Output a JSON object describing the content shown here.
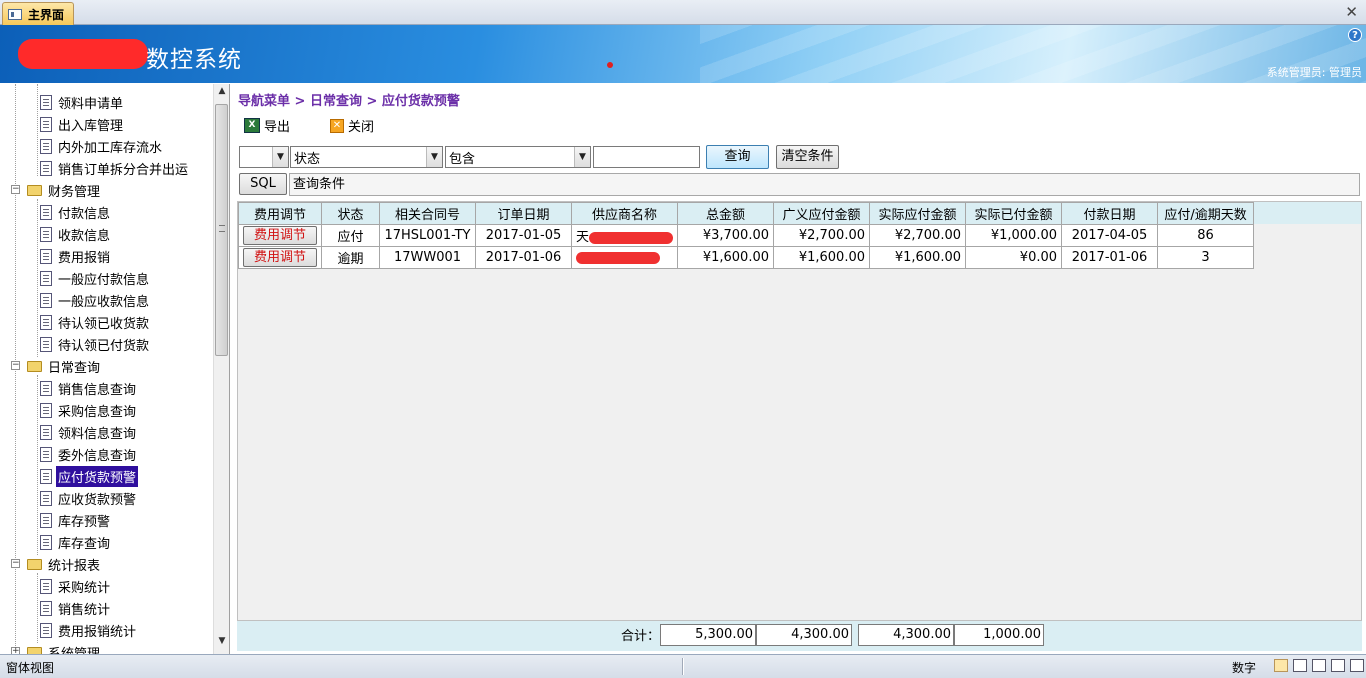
{
  "tab": {
    "title": "主界面"
  },
  "banner": {
    "title": "数控系统",
    "user": "系统管理员: 管理员"
  },
  "tree": {
    "items": [
      {
        "label": "领料申请单",
        "type": "doc"
      },
      {
        "label": "出入库管理",
        "type": "doc"
      },
      {
        "label": "内外加工库存流水",
        "type": "doc"
      },
      {
        "label": "销售订单拆分合并出运",
        "type": "doc"
      },
      {
        "label": "财务管理",
        "type": "folder"
      },
      {
        "label": "付款信息",
        "type": "doc"
      },
      {
        "label": "收款信息",
        "type": "doc"
      },
      {
        "label": "费用报销",
        "type": "doc"
      },
      {
        "label": "一般应付款信息",
        "type": "doc"
      },
      {
        "label": "一般应收款信息",
        "type": "doc"
      },
      {
        "label": "待认领已收货款",
        "type": "doc"
      },
      {
        "label": "待认领已付货款",
        "type": "doc"
      },
      {
        "label": "日常查询",
        "type": "folder"
      },
      {
        "label": "销售信息查询",
        "type": "doc"
      },
      {
        "label": "采购信息查询",
        "type": "doc"
      },
      {
        "label": "领料信息查询",
        "type": "doc"
      },
      {
        "label": "委外信息查询",
        "type": "doc"
      },
      {
        "label": "应付货款预警",
        "type": "doc",
        "selected": true
      },
      {
        "label": "应收货款预警",
        "type": "doc"
      },
      {
        "label": "库存预警",
        "type": "doc"
      },
      {
        "label": "库存查询",
        "type": "doc"
      },
      {
        "label": "统计报表",
        "type": "folder"
      },
      {
        "label": "采购统计",
        "type": "doc"
      },
      {
        "label": "销售统计",
        "type": "doc"
      },
      {
        "label": "费用报销统计",
        "type": "doc"
      },
      {
        "label": "系统管理",
        "type": "folder"
      }
    ]
  },
  "main": {
    "breadcrumb": "导航菜单 > 日常查询 > 应付货款预警",
    "export_label": "导出",
    "close_label": "关闭",
    "filter": {
      "field1": "",
      "field2": "状态",
      "operator": "包含",
      "value": "",
      "query_label": "查询",
      "clear_label": "清空条件",
      "sql_label": "SQL",
      "condition_text": "查询条件"
    },
    "columns": [
      "费用调节",
      "状态",
      "相关合同号",
      "订单日期",
      "供应商名称",
      "总金额",
      "广义应付金额",
      "实际应付金额",
      "实际已付金额",
      "付款日期",
      "应付/逾期天数"
    ],
    "rows": [
      {
        "btn": "费用调节",
        "status": "应付",
        "contract": "17HSL001-TY",
        "order_date": "2017-01-05",
        "supplier": "天",
        "total": "¥3,700.00",
        "general_payable": "¥2,700.00",
        "actual_payable": "¥2,700.00",
        "paid": "¥1,000.00",
        "pay_date": "2017-04-05",
        "days": "86"
      },
      {
        "btn": "费用调节",
        "status": "逾期",
        "contract": "17WW001",
        "order_date": "2017-01-06",
        "supplier": "",
        "total": "¥1,600.00",
        "general_payable": "¥1,600.00",
        "actual_payable": "¥1,600.00",
        "paid": "¥0.00",
        "pay_date": "2017-01-06",
        "days": "3"
      }
    ],
    "totals": {
      "label": "合计：",
      "total": "5,300.00",
      "general_payable": "4,300.00",
      "actual_payable": "4,300.00",
      "paid": "1,000.00"
    }
  },
  "statusbar": {
    "left": "窗体视图",
    "numlock": "数字"
  }
}
